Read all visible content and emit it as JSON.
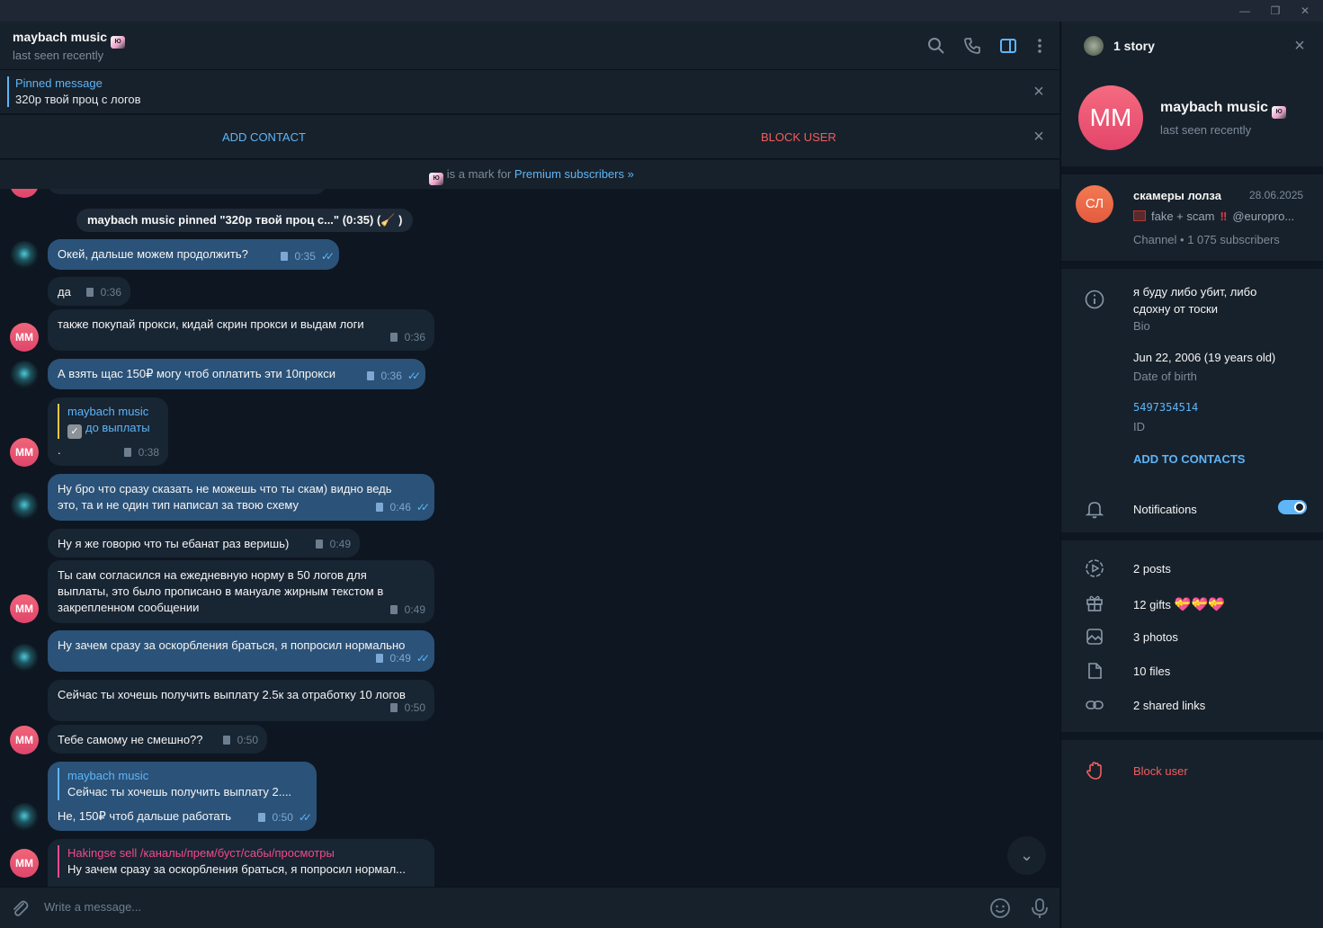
{
  "window": {
    "minimize_icon": "minimize-icon",
    "restore_icon": "restore-icon",
    "close_icon": "close-icon"
  },
  "chat_header": {
    "title": "maybach music",
    "status": "last seen recently"
  },
  "pinned": {
    "title": "Pinned message",
    "text": "320р твой проц с логов"
  },
  "actions": {
    "add_contact": "ADD CONTACT",
    "block_user": "BLOCK USER"
  },
  "premium_note": {
    "text": " is a mark for ",
    "link": "Premium subscribers »"
  },
  "messages": {
    "service": "maybach music pinned \"320р твой проц с...\" (0:35) (",
    "service_end": " )",
    "m1": {
      "text": "Окей, дальше можем продолжить?",
      "time": "0:35"
    },
    "m2": {
      "text": "да",
      "time": "0:36"
    },
    "m3": {
      "text": "также покупай прокси, кидай скрин прокси и выдам логи",
      "time": "0:36"
    },
    "m4": {
      "text": "А взять щас 150₽ могу чтоб оплатить эти 10прокси",
      "time": "0:36"
    },
    "m5": {
      "reply_name": "maybach music",
      "reply_text": "до выплаты",
      "text": ".",
      "time": "0:38"
    },
    "m6": {
      "line1": "Ну бро что сразу сказать не можешь что ты скам) видно ведь",
      "line2": "это, та и не один тип написал за твою схему",
      "time": "0:46"
    },
    "m7": {
      "text": "Ну я же говорю что ты ебанат раз веришь)",
      "time": "0:49"
    },
    "m8": {
      "line1": "Ты сам согласился на ежедневную норму в 50 логов для",
      "line2": "выплаты, это было прописано в мануале жирным текстом в",
      "line3": "закрепленном сообщении",
      "time": "0:49"
    },
    "m9": {
      "text": "Ну зачем сразу за оскорбления браться, я попросил нормально",
      "time": "0:49"
    },
    "m10": {
      "text": "Сейчас ты хочешь получить выплату 2.5к за отработку 10 логов",
      "time": "0:50"
    },
    "m11": {
      "text": "Тебе самому не смешно??",
      "time": "0:50"
    },
    "m12": {
      "reply_name": "maybach music",
      "reply_text": "Сейчас ты хочешь получить выплату 2....",
      "text": "Не, 150₽ чтоб дальше работать",
      "time": "0:50"
    },
    "m13": {
      "reply_name": "Hakingse sell /каналы/прем/буст/сабы/просмотры",
      "reply_text": "Ну зачем сразу за оскорбления браться, я попросил нормал..."
    },
    "avatar_initials": "MM"
  },
  "composer": {
    "placeholder": "Write a message..."
  },
  "profile": {
    "stories": "1 story",
    "initials": "MM",
    "name": "maybach music",
    "status": "last seen recently",
    "channel": {
      "initials": "СЛ",
      "name": "скамеры лолза",
      "date": "28.06.2025",
      "preview_text": "fake + scam",
      "preview_mention": "@europro...",
      "meta": "Channel • 1 075 subscribers"
    },
    "bio_line1": "я буду либо убит, либо",
    "bio_line2": "сдохну от тоски",
    "bio_label": "Bio",
    "dob": "Jun 22, 2006 (19 years old)",
    "dob_label": "Date of birth",
    "id": "5497354514",
    "id_label": "ID",
    "add_to_contacts": "ADD TO CONTACTS",
    "notifications": "Notifications",
    "notifications_on": true,
    "posts": "2 posts",
    "gifts": "12 gifts",
    "photos": "3 photos",
    "files": "10 files",
    "links": "2 shared links",
    "block": "Block user"
  },
  "colors": {
    "accent": "#5eb5f7",
    "danger": "#f25d5d",
    "bg": "#0e1621",
    "panel": "#17212b",
    "outgoing": "#2b5278",
    "incoming": "#182533"
  }
}
